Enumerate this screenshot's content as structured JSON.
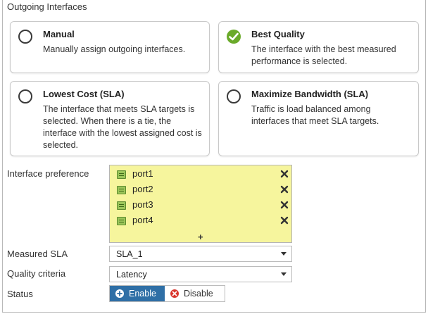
{
  "outgoing": {
    "title": "Outgoing Interfaces",
    "options": [
      {
        "title": "Manual",
        "desc": "Manually assign outgoing interfaces.",
        "selected": false
      },
      {
        "title": "Best Quality",
        "desc": "The interface with the best measured performance is selected.",
        "selected": true
      },
      {
        "title": "Lowest Cost (SLA)",
        "desc": "The interface that meets SLA targets is selected. When there is a tie, the interface with the lowest assigned cost is selected.",
        "selected": false
      },
      {
        "title": "Maximize Bandwidth (SLA)",
        "desc": "Traffic is load balanced among interfaces that meet SLA targets.",
        "selected": false
      }
    ]
  },
  "interface_preference": {
    "label": "Interface preference",
    "ports": [
      "port1",
      "port2",
      "port3",
      "port4"
    ],
    "add_symbol": "+"
  },
  "measured_sla": {
    "label": "Measured SLA",
    "value": "SLA_1"
  },
  "quality_criteria": {
    "label": "Quality criteria",
    "value": "Latency"
  },
  "status": {
    "label": "Status",
    "enable_label": "Enable",
    "disable_label": "Disable",
    "selected": "Enable"
  },
  "colors": {
    "selected_check": "#6aaa2a",
    "interface_box_bg": "#f6f59d",
    "enable_bg": "#2f6fa6",
    "disable_icon": "#d9342b"
  },
  "icons": {
    "port": "port-icon",
    "remove": "close-icon",
    "add": "plus-icon",
    "dropdown": "chevron-down-icon"
  }
}
